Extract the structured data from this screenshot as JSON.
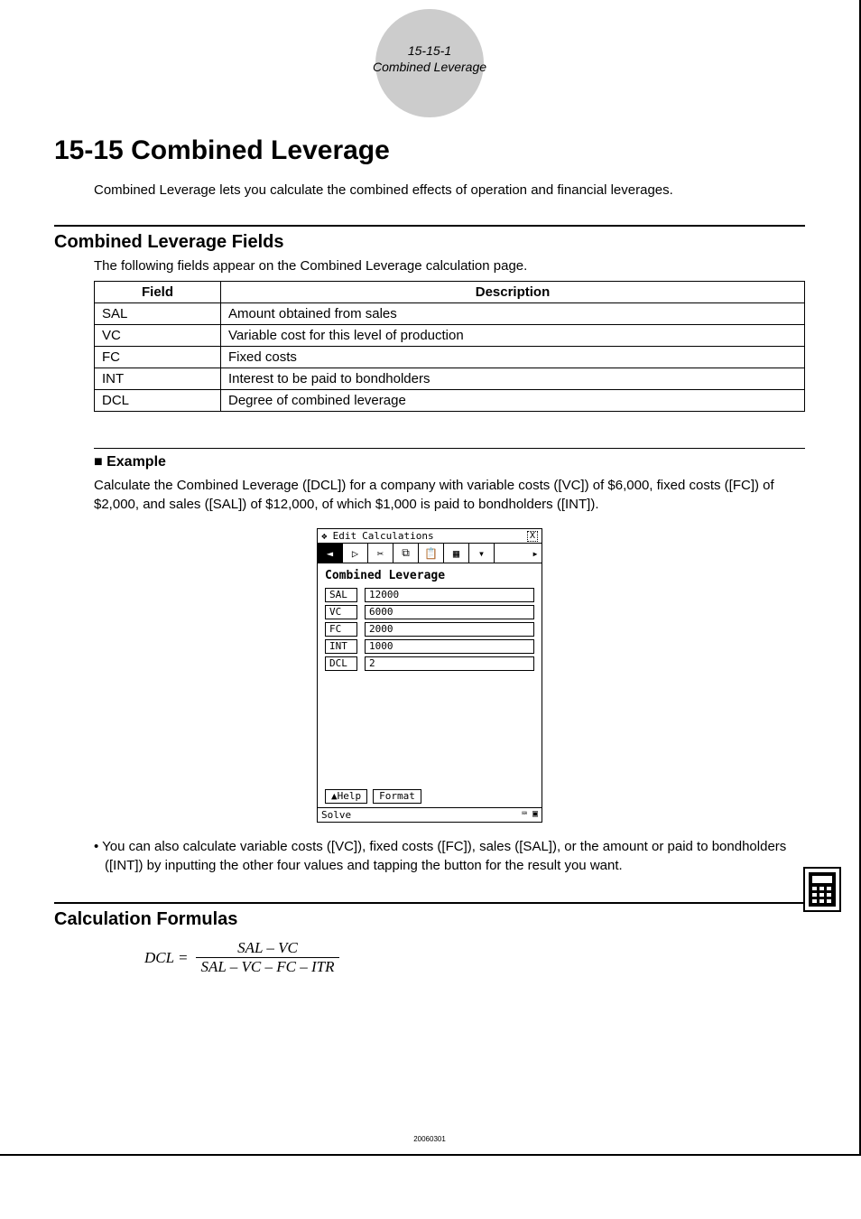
{
  "header": {
    "page_num": "15-15-1",
    "page_title": "Combined Leverage"
  },
  "title": "15-15  Combined Leverage",
  "intro": "Combined Leverage lets you calculate the combined effects of operation and financial leverages.",
  "fields_section": {
    "heading": "Combined Leverage Fields",
    "note": "The following fields appear on the Combined Leverage calculation page.",
    "col_field": "Field",
    "col_desc": "Description",
    "rows": [
      {
        "field": "SAL",
        "desc": "Amount obtained from sales"
      },
      {
        "field": "VC",
        "desc": "Variable cost for this level of production"
      },
      {
        "field": "FC",
        "desc": "Fixed costs"
      },
      {
        "field": "INT",
        "desc": "Interest to be paid to bondholders"
      },
      {
        "field": "DCL",
        "desc": "Degree of combined leverage"
      }
    ]
  },
  "example": {
    "heading": "Example",
    "text": "Calculate the Combined Leverage ([DCL]) for a company with variable costs ([VC]) of $6,000, fixed costs ([FC]) of $2,000, and sales ([SAL]) of $12,000, of which $1,000 is paid to bondholders ([INT])."
  },
  "calculator": {
    "menu_edit": "Edit",
    "menu_calc": "Calculations",
    "title": "Combined Leverage",
    "rows": [
      {
        "label": "SAL",
        "value": "12000"
      },
      {
        "label": "VC",
        "value": "6000"
      },
      {
        "label": "FC",
        "value": "2000"
      },
      {
        "label": "INT",
        "value": "1000"
      },
      {
        "label": "DCL",
        "value": "2"
      }
    ],
    "btn_help": "▲Help",
    "btn_format": "Format",
    "status": "Solve"
  },
  "bullet": "• You can also calculate variable costs ([VC]), fixed costs ([FC]), sales ([SAL]), or the amount or paid to bondholders ([INT]) by inputting the other four values and tapping the button for the result you want.",
  "formulas": {
    "heading": "Calculation Formulas",
    "lhs": "DCL =",
    "numerator": "SAL – VC",
    "denominator": "SAL – VC – FC – ITR"
  },
  "footer": "20060301"
}
